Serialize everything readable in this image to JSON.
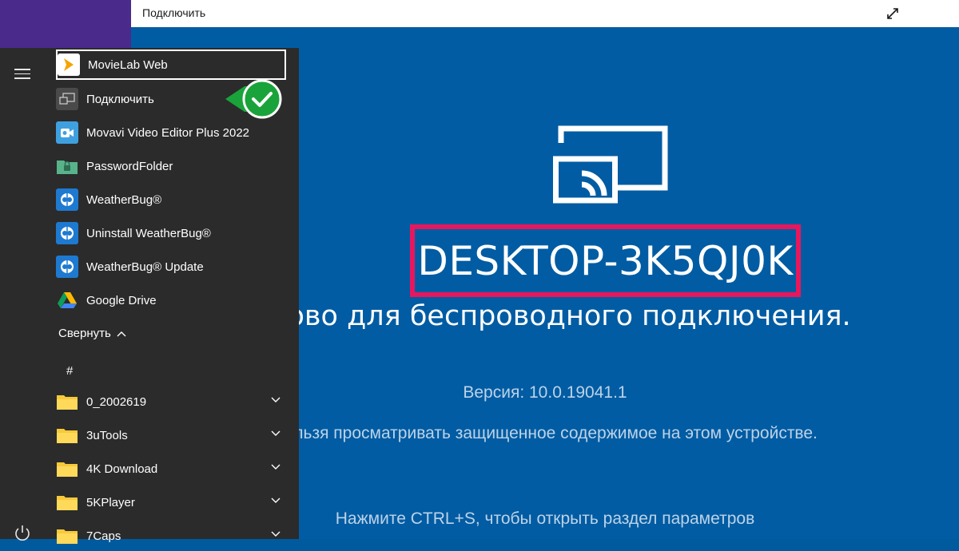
{
  "window": {
    "title": "Подключить",
    "expand_icon": "expand-icon"
  },
  "connect": {
    "device_name": "DESKTOP-3K5QJ0K",
    "ready": "готово для беспроводного подключения.",
    "version": "Версия: 10.0.19041.1",
    "protected": "Нельзя просматривать защищенное содержимое на этом устройстве.",
    "hint": "Нажмите CTRL+S, чтобы открыть раздел параметров",
    "highlight_color": "#e8175d",
    "background_color": "#015ca3"
  },
  "start_menu": {
    "apps": [
      {
        "label": "MovieLab Web",
        "icon": "movielab-icon"
      },
      {
        "label": "Подключить",
        "icon": "connect-icon"
      },
      {
        "label": "Movavi Video Editor Plus 2022",
        "icon": "movavi-icon"
      },
      {
        "label": "PasswordFolder",
        "icon": "password-folder-icon"
      },
      {
        "label": "WeatherBug®",
        "icon": "weatherbug-icon"
      },
      {
        "label": "Uninstall WeatherBug®",
        "icon": "weatherbug-icon"
      },
      {
        "label": "WeatherBug® Update",
        "icon": "weatherbug-icon"
      },
      {
        "label": "Google Drive",
        "icon": "google-drive-icon"
      }
    ],
    "collapse_label": "Свернуть",
    "section_letter": "#",
    "folders": [
      {
        "label": "0_2002619"
      },
      {
        "label": "3uTools"
      },
      {
        "label": "4K Download"
      },
      {
        "label": "5KPlayer"
      },
      {
        "label": "7Caps"
      }
    ]
  }
}
